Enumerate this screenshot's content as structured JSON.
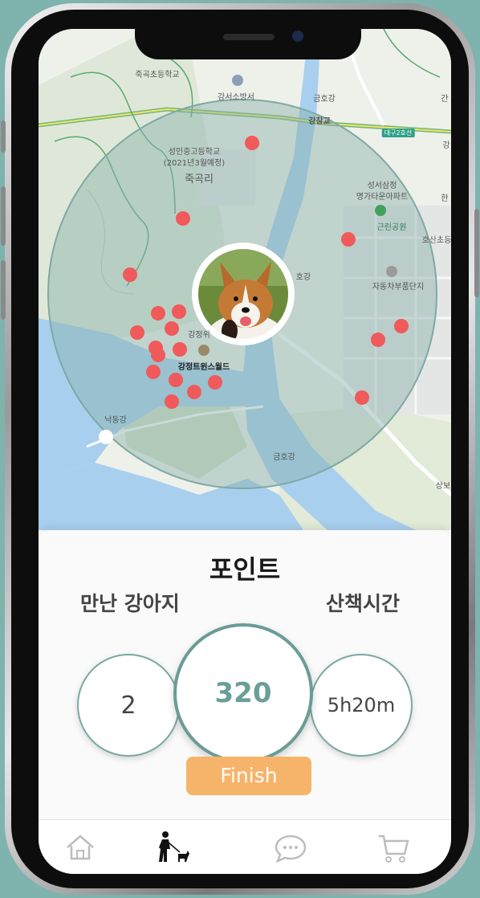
{
  "map": {
    "labels": {
      "juk_school": "죽곡초등학교",
      "fire_station": "강서소방서",
      "geumho_river_top": "금호강",
      "gangchang_bridge": "강창교",
      "road_badge": "대구2호선",
      "gang_right": "강",
      "gan_right_top": "간",
      "seongin_school": "성인중고등학교",
      "opening_note": "(2021년3월예정)",
      "jukgok_ri": "죽곡리",
      "seongseo_apt_1": "성서삼정",
      "seongseo_apt_2": "명가타운아파트",
      "han": "한",
      "neighborhood_park": "근린공원",
      "hosan_school": "호산초등",
      "geumho_river_mid": "호강",
      "auto_parts": "자동차부품단지",
      "gangjeong_short": "강정위",
      "gangjeong_weir": "강정트윈스월드",
      "nakdong_river": "낙동강",
      "geumho_river_bottom": "금호강",
      "sangbo": "상보"
    }
  },
  "stats": {
    "title": "포인트",
    "dogs_met_label": "만난 강아지",
    "dogs_met_value": "2",
    "points_value": "320",
    "walk_time_label": "산책시간",
    "walk_time_value": "5h20m",
    "finish_label": "Finish"
  },
  "tabs": [
    "home-icon",
    "dog-walk-icon",
    "chat-icon",
    "cart-icon"
  ],
  "colors": {
    "accent": "#6a9c97",
    "finish": "#f6b46a",
    "point_marker": "#f05a5a",
    "radius_fill": "#9fbfbb"
  }
}
